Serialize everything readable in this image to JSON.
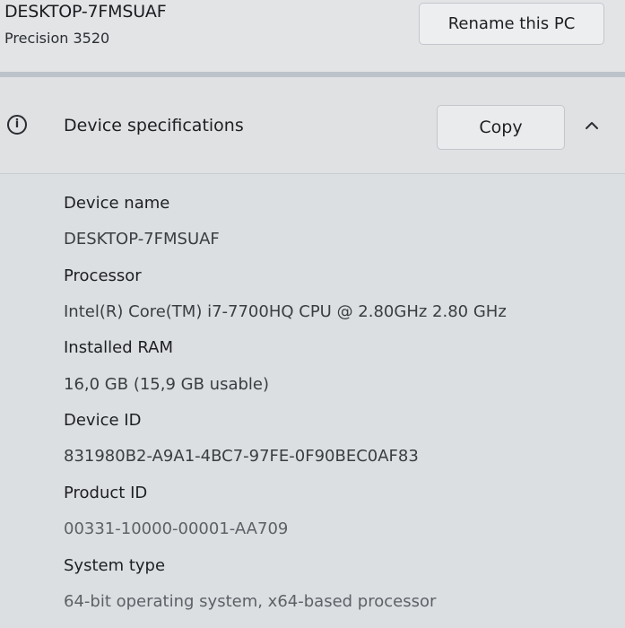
{
  "header": {
    "pc_name": "DESKTOP-7FMSUAF",
    "model": "Precision 3520",
    "rename_label": "Rename this PC"
  },
  "specs_section": {
    "icon": "info-icon",
    "title": "Device specifications",
    "copy_label": "Copy",
    "collapse_icon": "chevron-up-icon",
    "items": [
      {
        "label": "Device name",
        "value": "DESKTOP-7FMSUAF"
      },
      {
        "label": "Processor",
        "value": "Intel(R) Core(TM) i7-7700HQ CPU @ 2.80GHz   2.80 GHz"
      },
      {
        "label": "Installed RAM",
        "value": "16,0 GB (15,9 GB usable)"
      },
      {
        "label": "Device ID",
        "value": "831980B2-A9A1-4BC7-97FE-0F90BEC0AF83"
      },
      {
        "label": "Product ID",
        "value": "00331-10000-00001-AA709"
      },
      {
        "label": "System type",
        "value": "64-bit operating system, x64-based processor"
      }
    ]
  }
}
